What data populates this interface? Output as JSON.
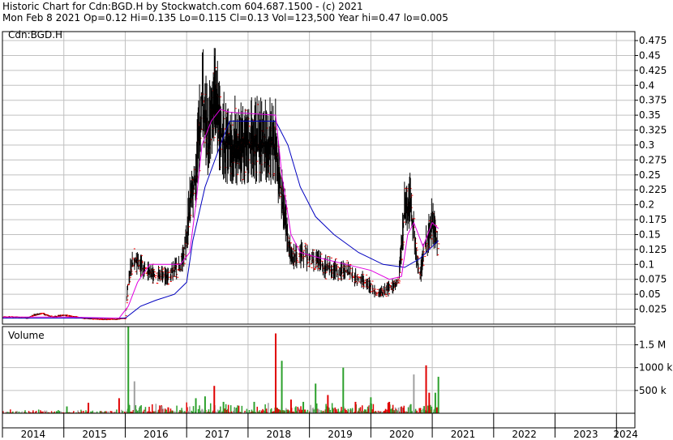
{
  "header": {
    "line1": "Historic Chart for Cdn:BGD.H by Stockwatch.com 604.687.1500 - (c) 2021",
    "line2": "Mon Feb  8 2021  Op=0.12  Hi=0.135  Lo=0.115  Cl=0.13  Vol=123,500  Year hi=0.47  lo=0.005"
  },
  "colors": {
    "price_bar": "#000000",
    "close_tick": "#ff0000",
    "ma_short": "#e000e0",
    "ma_long": "#0000c0",
    "vol_up": "#2ca02c",
    "vol_down": "#e00000",
    "vol_neutral": "#a0a0a0",
    "grid": "#c0c0c0"
  },
  "chart_data": [
    {
      "type": "line",
      "title": "Cdn:BGD.H",
      "xlabel": "",
      "ylabel": "",
      "x_ticks": [
        "2014",
        "2015",
        "2016",
        "2017",
        "2018",
        "2019",
        "2020",
        "2021",
        "2022",
        "2023",
        "2024"
      ],
      "y_ticks": [
        0.025,
        0.05,
        0.075,
        0.1,
        0.125,
        0.15,
        0.175,
        0.2,
        0.225,
        0.25,
        0.275,
        0.3,
        0.325,
        0.35,
        0.375,
        0.4,
        0.425,
        0.45,
        0.475
      ],
      "ylim": [
        0,
        0.49
      ],
      "xlim": [
        2014.0,
        2024.3
      ],
      "grid": true,
      "legend": "none",
      "price_series": [
        {
          "x": 2014.0,
          "y": 0.012
        },
        {
          "x": 2014.2,
          "y": 0.012
        },
        {
          "x": 2014.4,
          "y": 0.01
        },
        {
          "x": 2014.5,
          "y": 0.015
        },
        {
          "x": 2014.65,
          "y": 0.018
        },
        {
          "x": 2014.8,
          "y": 0.012
        },
        {
          "x": 2015.0,
          "y": 0.015
        },
        {
          "x": 2015.3,
          "y": 0.01
        },
        {
          "x": 2015.6,
          "y": 0.008
        },
        {
          "x": 2015.85,
          "y": 0.008
        },
        {
          "x": 2016.0,
          "y": 0.01
        },
        {
          "x": 2016.05,
          "y": 0.08
        },
        {
          "x": 2016.15,
          "y": 0.11
        },
        {
          "x": 2016.3,
          "y": 0.09
        },
        {
          "x": 2016.5,
          "y": 0.08
        },
        {
          "x": 2016.7,
          "y": 0.08
        },
        {
          "x": 2016.9,
          "y": 0.1
        },
        {
          "x": 2017.0,
          "y": 0.14
        },
        {
          "x": 2017.05,
          "y": 0.2
        },
        {
          "x": 2017.15,
          "y": 0.25
        },
        {
          "x": 2017.25,
          "y": 0.38
        },
        {
          "x": 2017.35,
          "y": 0.3
        },
        {
          "x": 2017.45,
          "y": 0.38
        },
        {
          "x": 2017.55,
          "y": 0.32
        },
        {
          "x": 2017.65,
          "y": 0.3
        },
        {
          "x": 2018.45,
          "y": 0.3
        },
        {
          "x": 2018.5,
          "y": 0.25
        },
        {
          "x": 2018.6,
          "y": 0.18
        },
        {
          "x": 2018.7,
          "y": 0.11
        },
        {
          "x": 2018.85,
          "y": 0.12
        },
        {
          "x": 2019.0,
          "y": 0.11
        },
        {
          "x": 2019.2,
          "y": 0.1
        },
        {
          "x": 2019.4,
          "y": 0.09
        },
        {
          "x": 2019.6,
          "y": 0.09
        },
        {
          "x": 2019.75,
          "y": 0.08
        },
        {
          "x": 2019.95,
          "y": 0.07
        },
        {
          "x": 2020.1,
          "y": 0.05
        },
        {
          "x": 2020.3,
          "y": 0.06
        },
        {
          "x": 2020.45,
          "y": 0.07
        },
        {
          "x": 2020.55,
          "y": 0.19
        },
        {
          "x": 2020.65,
          "y": 0.2
        },
        {
          "x": 2020.72,
          "y": 0.13
        },
        {
          "x": 2020.8,
          "y": 0.08
        },
        {
          "x": 2020.9,
          "y": 0.14
        },
        {
          "x": 2021.0,
          "y": 0.17
        },
        {
          "x": 2021.05,
          "y": 0.15
        },
        {
          "x": 2021.1,
          "y": 0.13
        }
      ],
      "ma_short": [
        {
          "x": 2014.0,
          "y": 0.012
        },
        {
          "x": 2015.0,
          "y": 0.012
        },
        {
          "x": 2015.9,
          "y": 0.01
        },
        {
          "x": 2016.05,
          "y": 0.03
        },
        {
          "x": 2016.2,
          "y": 0.07
        },
        {
          "x": 2016.4,
          "y": 0.1
        },
        {
          "x": 2016.9,
          "y": 0.1
        },
        {
          "x": 2017.05,
          "y": 0.12
        },
        {
          "x": 2017.15,
          "y": 0.2
        },
        {
          "x": 2017.25,
          "y": 0.3
        },
        {
          "x": 2017.4,
          "y": 0.34
        },
        {
          "x": 2017.55,
          "y": 0.36
        },
        {
          "x": 2017.7,
          "y": 0.355
        },
        {
          "x": 2018.45,
          "y": 0.35
        },
        {
          "x": 2018.55,
          "y": 0.25
        },
        {
          "x": 2018.7,
          "y": 0.15
        },
        {
          "x": 2018.85,
          "y": 0.12
        },
        {
          "x": 2019.2,
          "y": 0.11
        },
        {
          "x": 2019.6,
          "y": 0.1
        },
        {
          "x": 2020.0,
          "y": 0.09
        },
        {
          "x": 2020.3,
          "y": 0.075
        },
        {
          "x": 2020.5,
          "y": 0.08
        },
        {
          "x": 2020.6,
          "y": 0.15
        },
        {
          "x": 2020.7,
          "y": 0.17
        },
        {
          "x": 2020.85,
          "y": 0.13
        },
        {
          "x": 2021.0,
          "y": 0.17
        },
        {
          "x": 2021.1,
          "y": 0.16
        }
      ],
      "ma_long": [
        {
          "x": 2014.0,
          "y": 0.01
        },
        {
          "x": 2015.0,
          "y": 0.01
        },
        {
          "x": 2016.0,
          "y": 0.01
        },
        {
          "x": 2016.25,
          "y": 0.03
        },
        {
          "x": 2016.5,
          "y": 0.04
        },
        {
          "x": 2016.8,
          "y": 0.05
        },
        {
          "x": 2017.0,
          "y": 0.07
        },
        {
          "x": 2017.1,
          "y": 0.14
        },
        {
          "x": 2017.3,
          "y": 0.23
        },
        {
          "x": 2017.55,
          "y": 0.3
        },
        {
          "x": 2017.7,
          "y": 0.34
        },
        {
          "x": 2018.45,
          "y": 0.34
        },
        {
          "x": 2018.65,
          "y": 0.3
        },
        {
          "x": 2018.85,
          "y": 0.23
        },
        {
          "x": 2019.1,
          "y": 0.18
        },
        {
          "x": 2019.4,
          "y": 0.15
        },
        {
          "x": 2019.8,
          "y": 0.12
        },
        {
          "x": 2020.2,
          "y": 0.1
        },
        {
          "x": 2020.55,
          "y": 0.095
        },
        {
          "x": 2020.8,
          "y": 0.11
        },
        {
          "x": 2021.0,
          "y": 0.13
        },
        {
          "x": 2021.1,
          "y": 0.14
        }
      ]
    },
    {
      "type": "bar",
      "title": "Volume",
      "y_ticks": [
        "500 k",
        "1000 k",
        "1.5 M"
      ],
      "y_tick_values": [
        500000,
        1000000,
        1500000
      ],
      "ylim": [
        0,
        1900000
      ],
      "volume_peaks": [
        {
          "x": 2015.05,
          "v": 150000,
          "c": "up"
        },
        {
          "x": 2015.4,
          "v": 230000,
          "c": "down"
        },
        {
          "x": 2015.9,
          "v": 330000,
          "c": "down"
        },
        {
          "x": 2016.05,
          "v": 1900000,
          "c": "up"
        },
        {
          "x": 2016.15,
          "v": 700000,
          "c": "neutral"
        },
        {
          "x": 2016.7,
          "v": 130000,
          "c": "down"
        },
        {
          "x": 2017.15,
          "v": 330000,
          "c": "up"
        },
        {
          "x": 2017.3,
          "v": 370000,
          "c": "up"
        },
        {
          "x": 2017.45,
          "v": 600000,
          "c": "down"
        },
        {
          "x": 2017.6,
          "v": 250000,
          "c": "up"
        },
        {
          "x": 2018.1,
          "v": 250000,
          "c": "up"
        },
        {
          "x": 2018.45,
          "v": 1750000,
          "c": "down"
        },
        {
          "x": 2018.55,
          "v": 1150000,
          "c": "up"
        },
        {
          "x": 2018.7,
          "v": 300000,
          "c": "down"
        },
        {
          "x": 2018.9,
          "v": 250000,
          "c": "up"
        },
        {
          "x": 2019.1,
          "v": 650000,
          "c": "up"
        },
        {
          "x": 2019.3,
          "v": 400000,
          "c": "down"
        },
        {
          "x": 2019.55,
          "v": 1000000,
          "c": "up"
        },
        {
          "x": 2019.75,
          "v": 250000,
          "c": "down"
        },
        {
          "x": 2020.0,
          "v": 350000,
          "c": "up"
        },
        {
          "x": 2020.3,
          "v": 250000,
          "c": "down"
        },
        {
          "x": 2020.65,
          "v": 200000,
          "c": "up"
        },
        {
          "x": 2020.7,
          "v": 850000,
          "c": "neutral"
        },
        {
          "x": 2020.9,
          "v": 1050000,
          "c": "down"
        },
        {
          "x": 2020.95,
          "v": 450000,
          "c": "down"
        },
        {
          "x": 2021.05,
          "v": 450000,
          "c": "up"
        },
        {
          "x": 2021.1,
          "v": 800000,
          "c": "up"
        }
      ]
    }
  ]
}
